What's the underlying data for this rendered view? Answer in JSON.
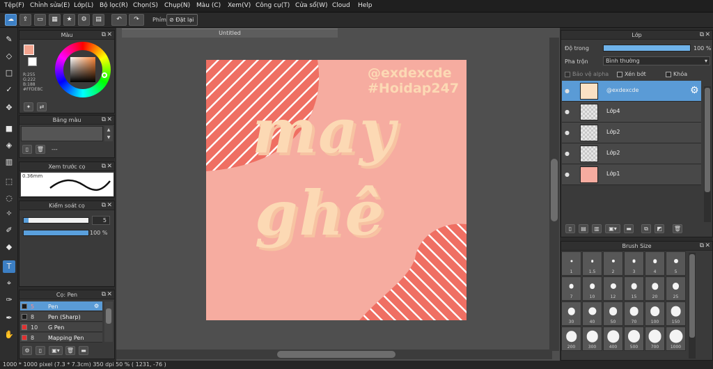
{
  "menu": [
    "Tệp(F)",
    "Chỉnh sửa(E)",
    "Lớp(L)",
    "Bộ lọc(R)",
    "Chọn(S)",
    "Chụp(N)",
    "Màu (C)",
    "Xem(V)",
    "Công cụ(T)",
    "Cửa sổ(W)",
    "Cloud",
    "Help"
  ],
  "toolbar": {
    "phim_label": "Phím",
    "reset_label": "Đặt lại"
  },
  "color_panel": {
    "title": "Màu",
    "r": "R:255",
    "g": "G:222",
    "b": "B:188",
    "hex": "#FFDEBC",
    "fg_color": "#f4a590",
    "bg_color": "#ffffff"
  },
  "palette_panel": {
    "title": "Bảng màu",
    "field_value": "---"
  },
  "preview_panel": {
    "title": "Xem trước cọ",
    "size": "0.36mm"
  },
  "brush_control": {
    "title": "Kiểm soát cọ",
    "size_value": "5",
    "opacity_value": "100 %",
    "size_fraction": 0.05,
    "opacity_fraction": 1.0
  },
  "brush_list": {
    "title": "Cọ: Pen",
    "items": [
      {
        "size": "5",
        "name": "Pen",
        "color": "#1b1b1b"
      },
      {
        "size": "8",
        "name": "Pen (Sharp)",
        "color": "#1b1b1b"
      },
      {
        "size": "10",
        "name": "G Pen",
        "color": "#e23030"
      },
      {
        "size": "8",
        "name": "Mapping Pen",
        "color": "#e23030"
      }
    ]
  },
  "document": {
    "tab_title": "Untitled"
  },
  "artwork": {
    "credit_line1": "@exdexcde",
    "credit_line2": "#Hoidap247",
    "word1": "may",
    "word2": "ghê",
    "bg_color": "#f6aca0",
    "stripe_color": "#ef6f63",
    "lettering_color": "#fcd9b4"
  },
  "layer_panel": {
    "title": "Lớp",
    "opacity_label": "Độ trong",
    "opacity_value": "100 %",
    "opacity_fraction": 1.0,
    "blend_label": "Pha trộn",
    "blend_value": "Bình thường",
    "alpha_protect": "Bảo vệ alpha",
    "clipping": "Xén bớt",
    "lock": "Khóa",
    "layers": [
      {
        "name": "@exdexcde",
        "selected": true
      },
      {
        "name": "Lớp4",
        "selected": false
      },
      {
        "name": "Lớp2",
        "selected": false
      },
      {
        "name": "Lớp2",
        "selected": false
      },
      {
        "name": "Lớp1",
        "selected": false
      }
    ]
  },
  "brush_size_panel": {
    "title": "Brush Size",
    "sizes": [
      "1",
      "1.5",
      "2",
      "3",
      "4",
      "5",
      "7",
      "10",
      "12",
      "15",
      "20",
      "25",
      "30",
      "40",
      "50",
      "70",
      "100",
      "150",
      "200",
      "300",
      "400",
      "500",
      "700",
      "1000"
    ]
  },
  "status": {
    "text": "1000 * 1000 pixel  (7.3 * 7.3cm)  350 dpi  50 %  ( 1231, -76 )"
  }
}
